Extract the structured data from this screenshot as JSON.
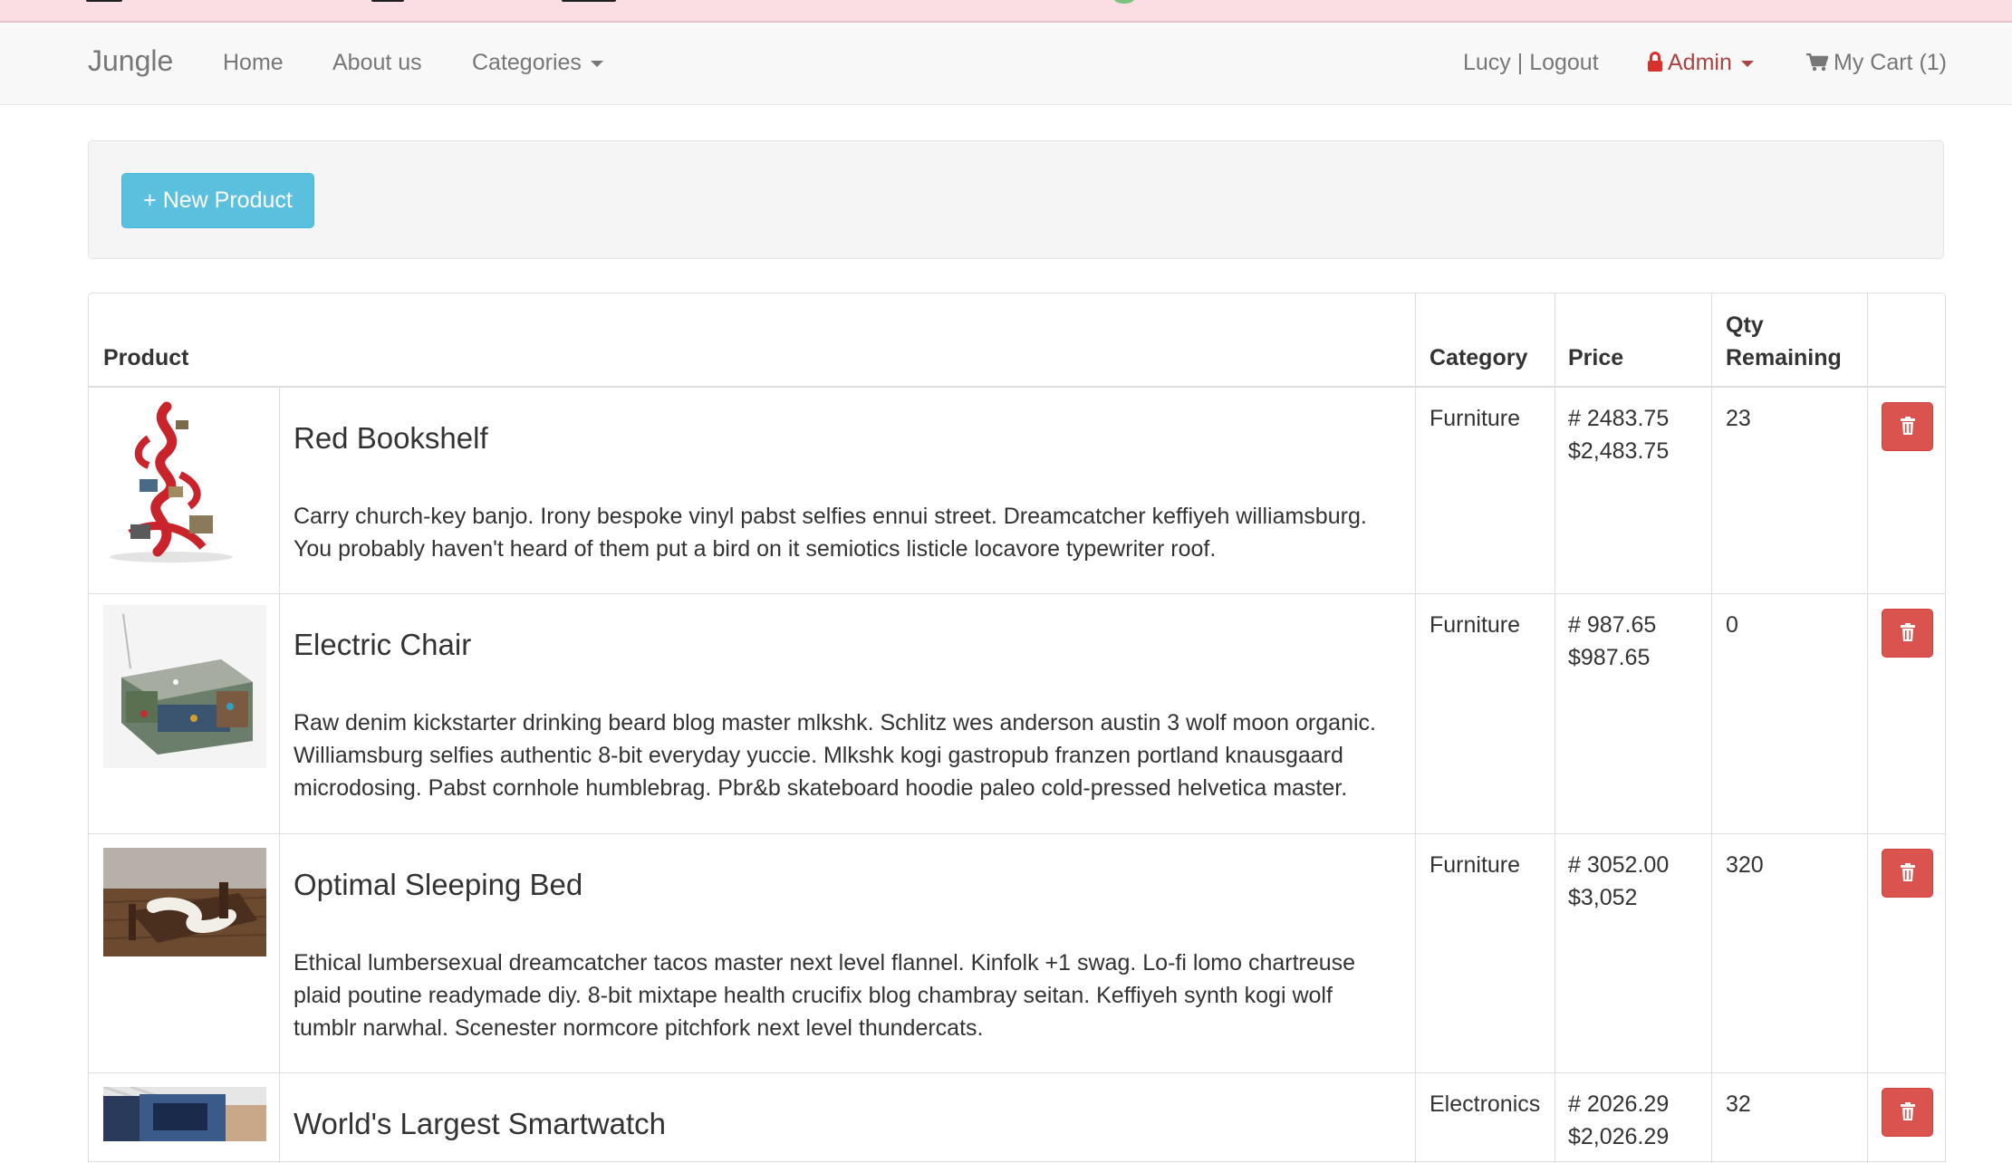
{
  "navbar": {
    "brand": "Jungle",
    "links": [
      "Home",
      "About us",
      "Categories"
    ],
    "user": "Lucy | Logout",
    "admin": "Admin",
    "cart": "My Cart (1)"
  },
  "toolbar": {
    "new_product": "+ New Product"
  },
  "table": {
    "headers": {
      "product": "Product",
      "category": "Category",
      "price": "Price",
      "qty_line1": "Qty",
      "qty_line2": "Remaining"
    },
    "rows": [
      {
        "name": "Red Bookshelf",
        "desc_line1": "Carry church-key banjo. Irony bespoke vinyl pabst selfies ennui street. Dreamcatcher keffiyeh williamsburg.",
        "desc_line2": "You probably haven't heard of them put a bird on it semiotics listicle locavore typewriter roof.",
        "category": "Furniture",
        "price_raw": "# 2483.75",
        "price": "$2,483.75",
        "qty": "23"
      },
      {
        "name": "Electric Chair",
        "desc_line1": "Raw denim kickstarter drinking beard blog master mlkshk. Schlitz wes anderson austin 3 wolf moon organic.",
        "desc_line2": "Williamsburg selfies authentic 8-bit everyday yuccie. Mlkshk kogi gastropub franzen portland knausgaard",
        "desc_line3": "microdosing. Pabst cornhole humblebrag. Pbr&b skateboard hoodie paleo cold-pressed helvetica master.",
        "category": "Furniture",
        "price_raw": "# 987.65",
        "price": "$987.65",
        "qty": "0"
      },
      {
        "name": "Optimal Sleeping Bed",
        "desc_line1": "Ethical lumbersexual dreamcatcher tacos master next level flannel. Kinfolk +1 swag. Lo-fi lomo chartreuse",
        "desc_line2": "plaid poutine readymade diy. 8-bit mixtape health crucifix blog chambray seitan. Keffiyeh synth kogi wolf",
        "desc_line3": "tumblr narwhal. Scenester normcore pitchfork next level thundercats.",
        "category": "Furniture",
        "price_raw": "# 3052.00",
        "price": "$3,052",
        "qty": "320"
      },
      {
        "name": "World's Largest Smartwatch",
        "category": "Electronics",
        "price_raw": "# 2026.29",
        "price": "$2,026.29",
        "qty": "32"
      }
    ]
  },
  "colors": {
    "info_button": "#5bc0de",
    "danger_button": "#d9534f",
    "admin_text": "#a94442",
    "navbar_bg": "#f8f8f8"
  },
  "icons": [
    "lock-icon",
    "cart-icon",
    "caret-down-icon",
    "trash-icon"
  ]
}
